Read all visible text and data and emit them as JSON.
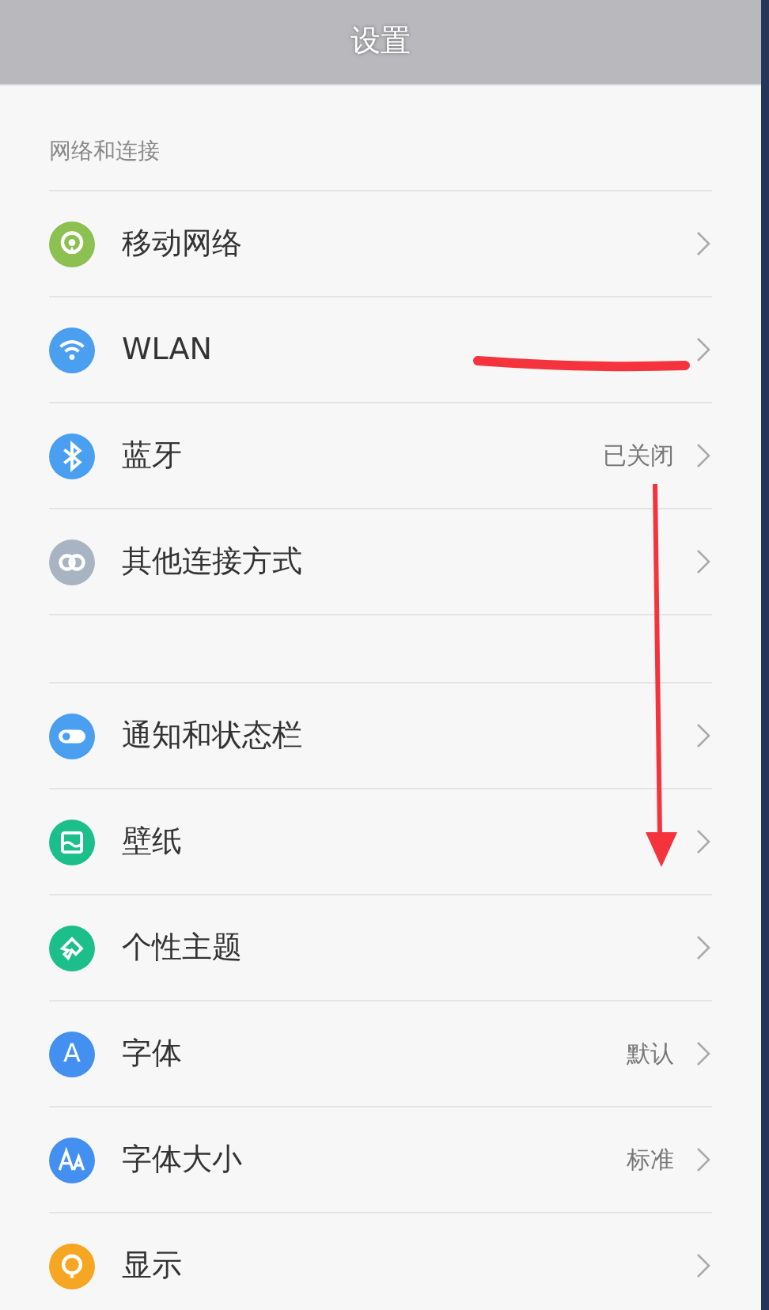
{
  "title": "设置",
  "sections": [
    {
      "title": "网络和连接",
      "items": [
        {
          "label": "移动网络",
          "color": "#8cc152"
        },
        {
          "label": "WLAN",
          "color": "#4a9ff0"
        },
        {
          "label": "蓝牙",
          "value": "已关闭",
          "color": "#4a9ff0"
        },
        {
          "label": "其他连接方式",
          "color": "#a9b4c2"
        }
      ]
    },
    {
      "items": [
        {
          "label": "通知和状态栏",
          "color": "#4a9ff0"
        },
        {
          "label": "壁纸",
          "color": "#1cbf8a"
        },
        {
          "label": "个性主题",
          "color": "#1cbf8a"
        },
        {
          "label": "字体",
          "value": "默认",
          "color": "#4390f0",
          "icon_text": "A"
        },
        {
          "label": "字体大小",
          "value": "标准",
          "color": "#4390f0"
        },
        {
          "label": "显示",
          "color": "#f5a623"
        }
      ]
    }
  ],
  "annotations": {
    "strike": true,
    "arrow": true
  }
}
